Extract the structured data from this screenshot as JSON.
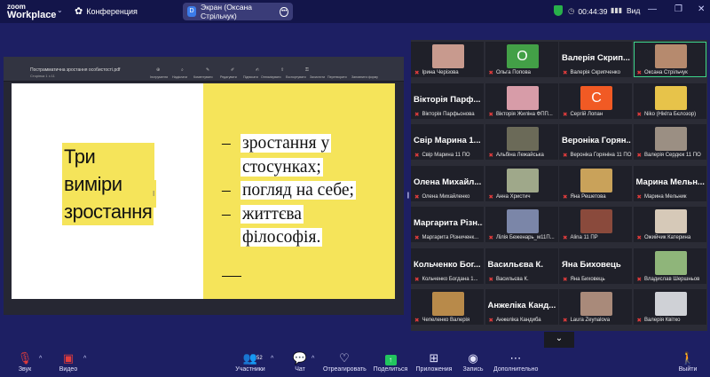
{
  "app": {
    "logo_line1": "zoom",
    "logo_line2": "Workplace",
    "conference_label": "Конференция",
    "share_label": "Экран (Оксана Стрільчук)",
    "timer": "00:44:39",
    "video_label": "Вид"
  },
  "doc": {
    "filename": "Пострамматична зростання особистості.pdf",
    "page_info": "Сторінка 1 з 11",
    "toolbar": [
      "Інструменти",
      "Надіслати",
      "Коментувати",
      "Редагувати",
      "Підписати",
      "Оптимізувати",
      "Експортувати",
      "Захистити",
      "Перетворити",
      "Заповнити форму"
    ]
  },
  "slide": {
    "title_line1": "Три виміри",
    "title_line2": "зростання",
    "bullets": [
      {
        "dash": "–",
        "line1": "зростання у",
        "line2": "стосунках;"
      },
      {
        "dash": "–",
        "line1": "погляд на себе;",
        "line2": ""
      },
      {
        "dash": "–",
        "line1": "життєва",
        "line2": "філософія."
      }
    ]
  },
  "participants": [
    {
      "name": "Ірина Черізова",
      "big": "",
      "avatar": "photo",
      "color": "#c89a8e"
    },
    {
      "name": "Ольга Попова",
      "big": "",
      "avatar": "О",
      "color": "#43a047"
    },
    {
      "name": "Валерія Скрипченко",
      "big": "Валерія Скрип...",
      "avatar": "",
      "color": ""
    },
    {
      "name": "Оксана Стрільчук",
      "big": "",
      "avatar": "photo",
      "color": "#b68a6e"
    },
    {
      "name": "Вікторія Парфьонова",
      "big": "Вікторія Парф...",
      "avatar": "",
      "color": ""
    },
    {
      "name": "Вікторія Жиліна ФПП...",
      "big": "",
      "avatar": "photo",
      "color": "#d79ca8"
    },
    {
      "name": "Сергій Лопан",
      "big": "",
      "avatar": "С",
      "color": "#f15a24"
    },
    {
      "name": "Niko (Нікіта Бєлозор)",
      "big": "",
      "avatar": "photo",
      "color": "#e7c34a"
    },
    {
      "name": "Свір Марина 11 ПО",
      "big": "Свір Марина 1...",
      "avatar": "",
      "color": ""
    },
    {
      "name": "Альбіна Лежайська",
      "big": "",
      "avatar": "photo",
      "color": "#6b6a58"
    },
    {
      "name": "Вероніка Горяніна 11 ПО",
      "big": "Вероніка Горян...",
      "avatar": "",
      "color": ""
    },
    {
      "name": "Валерія Сердюк 11 ПО",
      "big": "",
      "avatar": "photo",
      "color": "#9b8f83"
    },
    {
      "name": "Олена Михайленко",
      "big": "Олена Михайл...",
      "avatar": "",
      "color": ""
    },
    {
      "name": "Анна Христич",
      "big": "",
      "avatar": "photo",
      "color": "#9fa88a"
    },
    {
      "name": "Яна Решетова",
      "big": "",
      "avatar": "photo",
      "color": "#c9a25a"
    },
    {
      "name": "Марина Мельник",
      "big": "Марина Мельн...",
      "avatar": "",
      "color": ""
    },
    {
      "name": "Маргарита Різниченк...",
      "big": "Маргарита Різн...",
      "avatar": "",
      "color": ""
    },
    {
      "name": "Лілія Беженарь_м11П...",
      "big": "",
      "avatar": "photo",
      "color": "#7b86a8"
    },
    {
      "name": "Alina 11 ПР",
      "big": "",
      "avatar": "photo",
      "color": "#8a4a3c"
    },
    {
      "name": "Ожийчик Катерина",
      "big": "",
      "avatar": "photo",
      "color": "#d6c9b8"
    },
    {
      "name": "Кольченко Богдана 1...",
      "big": "Кольченко Бог...",
      "avatar": "",
      "color": ""
    },
    {
      "name": "Васильєва К.",
      "big": "Васильєва К.",
      "avatar": "",
      "color": ""
    },
    {
      "name": "Яна Биховець",
      "big": "Яна Биховець",
      "avatar": "",
      "color": ""
    },
    {
      "name": "Владислав Шершньов",
      "big": "",
      "avatar": "photo",
      "color": "#8fb57a"
    },
    {
      "name": "Чепеленко Валерія",
      "big": "",
      "avatar": "photo",
      "color": "#b88a4a"
    },
    {
      "name": "Анжеліка Кандиба",
      "big": "Анжеліка Канд...",
      "avatar": "",
      "color": ""
    },
    {
      "name": "Laura Zeynalova",
      "big": "",
      "avatar": "photo",
      "color": "#a98a7a"
    },
    {
      "name": "Валерія Квітко",
      "big": "",
      "avatar": "photo",
      "color": "#cfd1d6"
    }
  ],
  "controls": {
    "audio": "Звук",
    "video": "Видео",
    "participants": "Участники",
    "participants_count": "52",
    "chat": "Чат",
    "react": "Отреагировать",
    "share": "Поделиться",
    "apps": "Приложения",
    "record": "Запись",
    "more": "Дополнительно",
    "leave": "Выйти"
  },
  "colors": {
    "background": "#1d1f63",
    "slide_yellow": "#f5e45a",
    "active_speaker": "#3dd68c",
    "muted_mic": "#e23c3c",
    "share_green": "#22c55e"
  }
}
